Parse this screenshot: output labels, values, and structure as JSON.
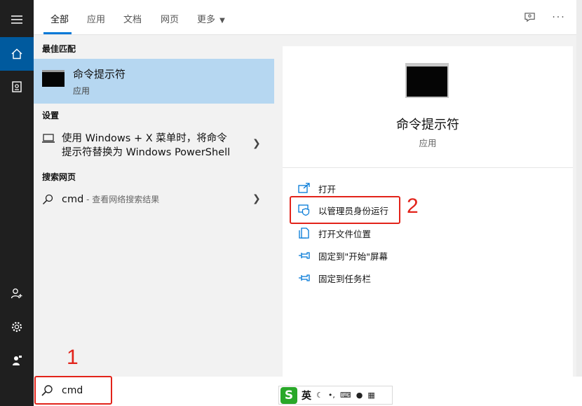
{
  "tabs": [
    {
      "label": "全部",
      "active": true
    },
    {
      "label": "应用"
    },
    {
      "label": "文档"
    },
    {
      "label": "网页"
    },
    {
      "label": "更多"
    }
  ],
  "more_icon": "ellipsis-icon",
  "sections": {
    "best_match": "最佳匹配",
    "settings": "设置",
    "web": "搜索网页"
  },
  "best_match": {
    "title": "命令提示符",
    "subtitle": "应用"
  },
  "settings_item": {
    "line1": "使用 Windows + X 菜单时，将命令",
    "line2": "提示符替换为 Windows PowerShell"
  },
  "web_item": {
    "query": "cmd",
    "suffix": " - 查看网络搜索结果"
  },
  "detail": {
    "title": "命令提示符",
    "subtitle": "应用",
    "actions": [
      "打开",
      "以管理员身份运行",
      "打开文件位置",
      "固定到\"开始\"屏幕",
      "固定到任务栏"
    ]
  },
  "annotations": {
    "label1": "1",
    "label2": "2"
  },
  "search": {
    "value": "cmd"
  },
  "ime": {
    "label": "英"
  },
  "colors": {
    "accent": "#0078d7",
    "annotation": "#e2231a",
    "selected": "#b6d7f1",
    "rail": "#1f1f1f"
  }
}
